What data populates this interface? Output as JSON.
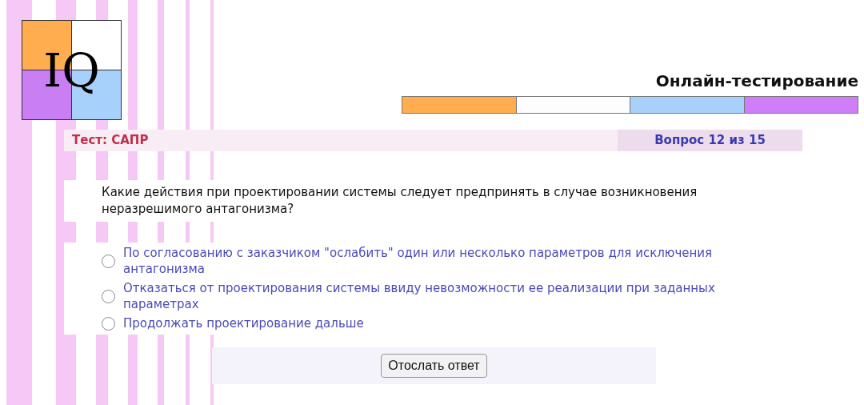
{
  "logo": {
    "text": "IQ"
  },
  "title": "Онлайн-тестирование",
  "test_label": "Тест: САПР",
  "question_counter": "Вопрос 12 из 15",
  "question": "Какие действия при проектировании системы следует предпринять в случае возникновения неразрешимого антагонизма?",
  "options": [
    {
      "label": "По согласованию с заказчиком \"ослабить\" один или несколько параметров для исключения антагонизма",
      "selected": false
    },
    {
      "label": "Отказаться от проектирования системы ввиду  невозможности ее реализации при заданных параметрах",
      "selected": false
    },
    {
      "label": "Продолжать проектирование дальше",
      "selected": false
    }
  ],
  "submit_button": "Отослать ответ"
}
